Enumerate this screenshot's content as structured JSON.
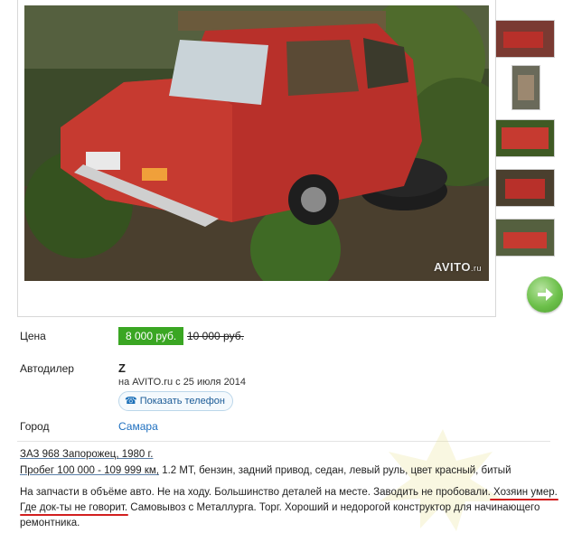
{
  "gallery": {
    "watermark": "AVITO",
    "watermark_suffix": ".ru",
    "thumb_count": 5
  },
  "listing": {
    "price_label": "Цена",
    "price": "8 000 руб.",
    "old_price": "10 000 руб.",
    "dealer_label": "Автодилер",
    "dealer_name": "Z",
    "dealer_since": "на AVITO.ru с 25 июля 2014",
    "phone_button": "Показать телефон",
    "city_label": "Город",
    "city": "Самара"
  },
  "description": {
    "line1": "ЗАЗ 968 Запорожец, 1980 г.",
    "line2a": "Пробег 100 000 - 109 999 км,",
    "line2b": " 1.2 MT, бензин, задний привод, седан, левый руль, цвет красный, битый",
    "line3": "На запчасти в объёме авто. Не на ходу. Большинство деталей на месте. Заводить не пробовали. Хозяин умер.",
    "line4": "Где док-ты не говорит. Самовывоз с Металлурга. Торг. Хороший и недорогой конструктор для начинающего",
    "line5": "ремонтника."
  },
  "colors": {
    "price_badge": "#3aa623",
    "link": "#1e6fbf",
    "annotation_red": "#d21f1f",
    "arrow_green": "#6cc04a"
  }
}
